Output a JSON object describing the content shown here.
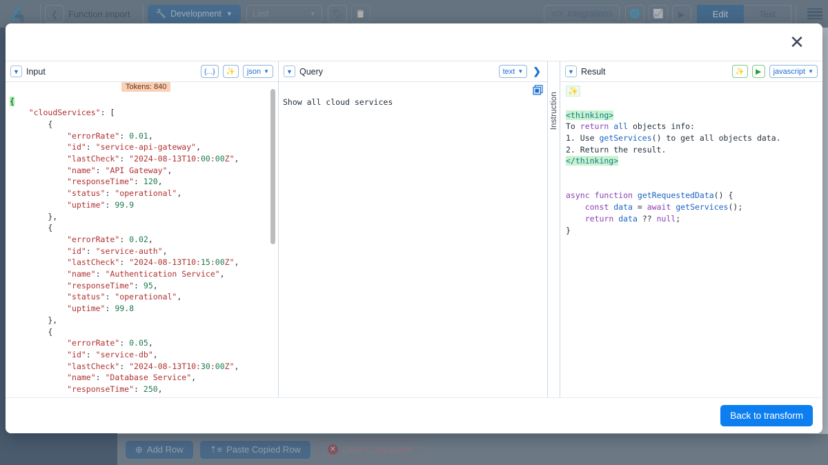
{
  "app": {
    "topbar": {
      "logo_icon": "triangle-logo-icon",
      "back_icon": "chevron-left-icon",
      "breadcrumb": "Function import",
      "environment_label": "Development",
      "environment_icon": "wrench-icon",
      "environment_caret": "chevron-down-icon",
      "version_select_value": "Last",
      "version_caret": "chevron-down-icon",
      "tag_icon": "tag-plus-icon",
      "copy_icon": "copy-icon",
      "integrations_label": "Integrations",
      "integrations_icon": "code-brackets-icon",
      "globe_icon": "globe-icon",
      "chart_icon": "bar-chart-icon",
      "play_icon": "play-circle-icon",
      "edit_label": "Edit",
      "test_label": "Test",
      "menu_icon": "hamburger-menu-icon"
    },
    "footer": {
      "add_row_label": "Add Row",
      "add_row_icon": "plus-circle-icon",
      "paste_row_label": "Paste Copied Row",
      "paste_row_icon": "paste-icon",
      "clear_buffer_label": "Clear Copy Buffer",
      "clear_buffer_icon": "x-circle-icon"
    }
  },
  "modal": {
    "close_icon": "close-icon",
    "back_button_label": "Back to transform",
    "input_panel": {
      "collapse_icon": "chevron-down-icon",
      "title": "Input",
      "ellipsis_button": "{...}",
      "magic_icon": "magic-wand-icon",
      "format_value": "json",
      "format_caret": "chevron-down-icon",
      "tokens_badge": "Tokens: 840",
      "code_lines": [
        "{",
        "    \"cloudServices\": [",
        "        {",
        "            \"errorRate\": 0.01,",
        "            \"id\": \"service-api-gateway\",",
        "            \"lastCheck\": \"2024-08-13T10:00:00Z\",",
        "            \"name\": \"API Gateway\",",
        "            \"responseTime\": 120,",
        "            \"status\": \"operational\",",
        "            \"uptime\": 99.9",
        "        },",
        "        {",
        "            \"errorRate\": 0.02,",
        "            \"id\": \"service-auth\",",
        "            \"lastCheck\": \"2024-08-13T10:15:00Z\",",
        "            \"name\": \"Authentication Service\",",
        "            \"responseTime\": 95,",
        "            \"status\": \"operational\",",
        "            \"uptime\": 99.8",
        "        },",
        "        {",
        "            \"errorRate\": 0.05,",
        "            \"id\": \"service-db\",",
        "            \"lastCheck\": \"2024-08-13T10:30:00Z\",",
        "            \"name\": \"Database Service\",",
        "            \"responseTime\": 250,"
      ]
    },
    "query_panel": {
      "collapse_icon": "chevron-down-icon",
      "title": "Query",
      "format_value": "text",
      "format_caret": "chevron-down-icon",
      "next_icon": "chevron-right-icon",
      "copy_icon": "copy-icon",
      "text": "Show all cloud services"
    },
    "instruction_rail": {
      "label": "Instruction"
    },
    "result_panel": {
      "collapse_icon": "chevron-down-icon",
      "title": "Result",
      "sparkle_icon": "sparkle-icon",
      "run_icon": "play-icon",
      "language_value": "javascript",
      "language_caret": "chevron-down-icon",
      "leading_sparkle": "sparkle-icon",
      "code_lines": [
        "<thinking>",
        "To return all objects info:",
        "1. Use getServices() to get all objects data.",
        "2. Return the result.",
        "</thinking>",
        "",
        "",
        "async function getRequestedData() {",
        "    const data = await getServices();",
        "    return data ?? null;",
        "}"
      ]
    }
  },
  "colors": {
    "accent_blue": "#0d7ef0",
    "topbar": "#5c6a78",
    "sidebar": "#1f3550",
    "primary_dark_blue": "#15548f",
    "tokens_badge_bg": "#fbd0b5",
    "thinking_highlight": "#c9f3cf",
    "danger": "#b9666c"
  }
}
